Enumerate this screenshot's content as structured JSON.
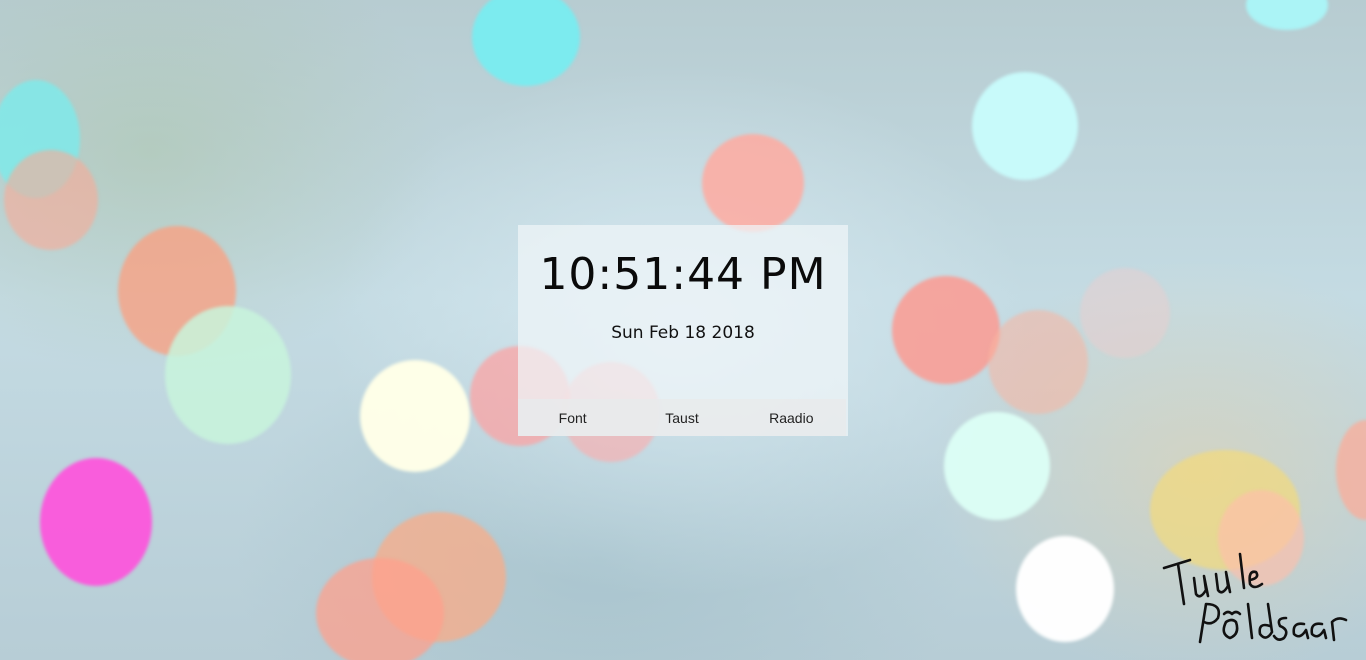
{
  "clock": {
    "time": "10:51:44 PM",
    "date": "Sun Feb 18 2018"
  },
  "menu": {
    "items": [
      {
        "label": "Font"
      },
      {
        "label": "Taust"
      },
      {
        "label": "Raadio"
      }
    ]
  },
  "signature": {
    "line1": "Tuule",
    "line2": "Põldsaar"
  },
  "colors": {
    "card": "#f0f5f8",
    "menu": "#e8eaeb",
    "text": "#0a0a0a"
  }
}
